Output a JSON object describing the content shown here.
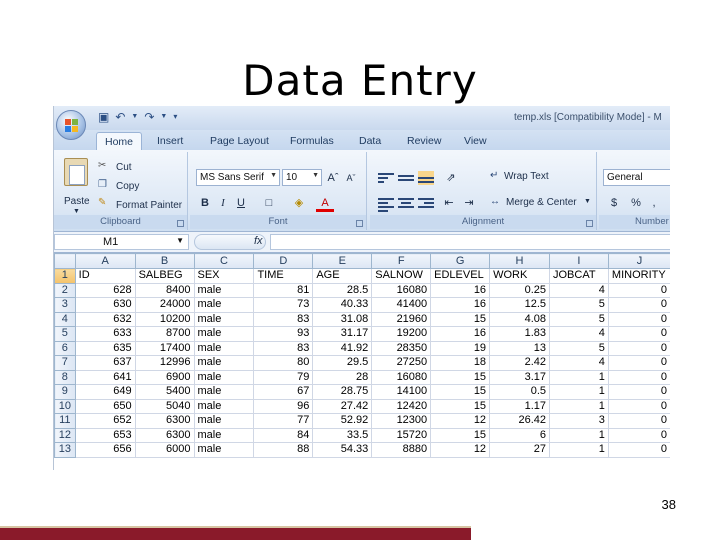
{
  "slide": {
    "title": "Data Entry",
    "page_number": "38"
  },
  "window": {
    "title": "temp.xls  [Compatibility Mode]  - M"
  },
  "tabs": [
    "Home",
    "Insert",
    "Page Layout",
    "Formulas",
    "Data",
    "Review",
    "View"
  ],
  "ribbon": {
    "clipboard": {
      "label": "Clipboard",
      "paste": "Paste",
      "cut": "Cut",
      "copy": "Copy",
      "format_painter": "Format Painter"
    },
    "font": {
      "label": "Font",
      "family": "MS Sans Serif",
      "size": "10",
      "bold": "B",
      "italic": "I",
      "underline": "U"
    },
    "alignment": {
      "label": "Alignment",
      "wrap_text": "Wrap Text",
      "merge_center": "Merge & Center"
    },
    "number": {
      "label": "Number",
      "format": "General",
      "percent": "%",
      "comma": ","
    }
  },
  "formula_bar": {
    "name_box": "M1",
    "fx": "fx",
    "value": ""
  },
  "sheet": {
    "columns": [
      "A",
      "B",
      "C",
      "D",
      "E",
      "F",
      "G",
      "H",
      "I",
      "J"
    ],
    "rows": [
      {
        "n": "1",
        "cells": [
          "ID",
          "SALBEG",
          "SEX",
          "TIME",
          "AGE",
          "SALNOW",
          "EDLEVEL",
          "WORK",
          "JOBCAT",
          "MINORITY"
        ]
      },
      {
        "n": "2",
        "cells": [
          "628",
          "8400",
          "male",
          "81",
          "28.5",
          "16080",
          "16",
          "0.25",
          "4",
          "0"
        ]
      },
      {
        "n": "3",
        "cells": [
          "630",
          "24000",
          "male",
          "73",
          "40.33",
          "41400",
          "16",
          "12.5",
          "5",
          "0"
        ]
      },
      {
        "n": "4",
        "cells": [
          "632",
          "10200",
          "male",
          "83",
          "31.08",
          "21960",
          "15",
          "4.08",
          "5",
          "0"
        ]
      },
      {
        "n": "5",
        "cells": [
          "633",
          "8700",
          "male",
          "93",
          "31.17",
          "19200",
          "16",
          "1.83",
          "4",
          "0"
        ]
      },
      {
        "n": "6",
        "cells": [
          "635",
          "17400",
          "male",
          "83",
          "41.92",
          "28350",
          "19",
          "13",
          "5",
          "0"
        ]
      },
      {
        "n": "7",
        "cells": [
          "637",
          "12996",
          "male",
          "80",
          "29.5",
          "27250",
          "18",
          "2.42",
          "4",
          "0"
        ]
      },
      {
        "n": "8",
        "cells": [
          "641",
          "6900",
          "male",
          "79",
          "28",
          "16080",
          "15",
          "3.17",
          "1",
          "0"
        ]
      },
      {
        "n": "9",
        "cells": [
          "649",
          "5400",
          "male",
          "67",
          "28.75",
          "14100",
          "15",
          "0.5",
          "1",
          "0"
        ]
      },
      {
        "n": "10",
        "cells": [
          "650",
          "5040",
          "male",
          "96",
          "27.42",
          "12420",
          "15",
          "1.17",
          "1",
          "0"
        ]
      },
      {
        "n": "11",
        "cells": [
          "652",
          "6300",
          "male",
          "77",
          "52.92",
          "12300",
          "12",
          "26.42",
          "3",
          "0"
        ]
      },
      {
        "n": "12",
        "cells": [
          "653",
          "6300",
          "male",
          "84",
          "33.5",
          "15720",
          "15",
          "6",
          "1",
          "0"
        ]
      },
      {
        "n": "13",
        "cells": [
          "656",
          "6000",
          "male",
          "88",
          "54.33",
          "8880",
          "12",
          "27",
          "1",
          "0"
        ]
      }
    ]
  },
  "colors": {
    "footer_bar": "#8a1a2a",
    "ribbon_bg": "#dde8f5",
    "header_bg": "#dce6f4"
  }
}
